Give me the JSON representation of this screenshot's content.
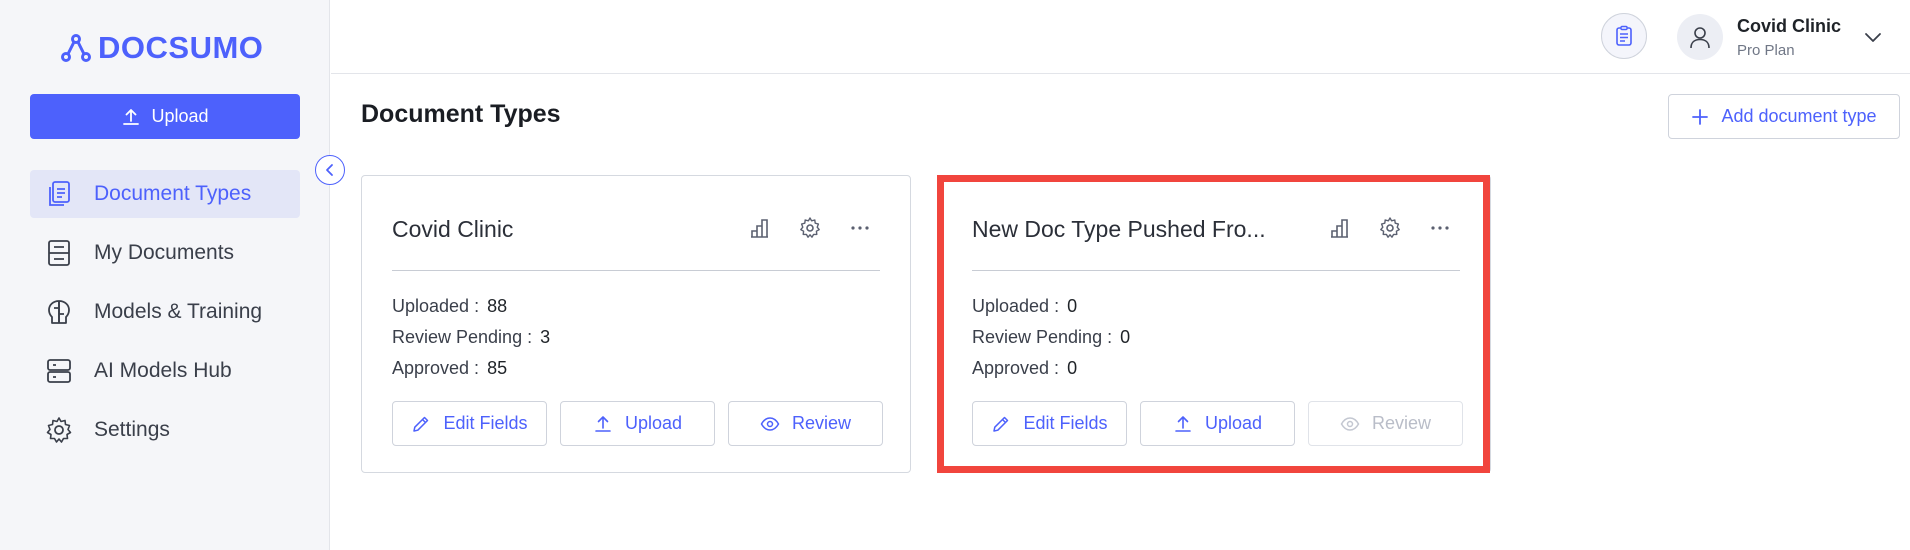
{
  "brand": {
    "name": "DOCSUMO",
    "color": "#4d61fc",
    "logo_icon": "docsumo-logo-icon"
  },
  "sidebar": {
    "upload_label": "Upload",
    "items": [
      {
        "label": "Document Types",
        "icon": "document-types-icon",
        "active": true
      },
      {
        "label": "My Documents",
        "icon": "my-documents-icon",
        "active": false
      },
      {
        "label": "Models & Training",
        "icon": "brain-icon",
        "active": false
      },
      {
        "label": "AI Models Hub",
        "icon": "server-icon",
        "active": false
      },
      {
        "label": "Settings",
        "icon": "gear-icon",
        "active": false
      }
    ]
  },
  "header": {
    "user_name": "Covid Clinic",
    "user_plan": "Pro Plan"
  },
  "main": {
    "title": "Document Types",
    "add_button_label": "Add document type",
    "cards": [
      {
        "title": "Covid Clinic",
        "stats": [
          {
            "label": "Uploaded :",
            "value": "88"
          },
          {
            "label": "Review Pending :",
            "value": "3"
          },
          {
            "label": "Approved :",
            "value": "85"
          }
        ],
        "actions": {
          "edit": "Edit Fields",
          "upload": "Upload",
          "review": "Review"
        },
        "review_enabled": true
      },
      {
        "title": "New Doc Type Pushed Fro...",
        "stats": [
          {
            "label": "Uploaded :",
            "value": "0"
          },
          {
            "label": "Review Pending :",
            "value": "0"
          },
          {
            "label": "Approved :",
            "value": "0"
          }
        ],
        "actions": {
          "edit": "Edit Fields",
          "upload": "Upload",
          "review": "Review"
        },
        "review_enabled": false,
        "highlighted": true
      }
    ]
  },
  "colors": {
    "accent": "#4d61fc",
    "highlight": "#f1453d",
    "disabled": "#b9bdc8"
  }
}
